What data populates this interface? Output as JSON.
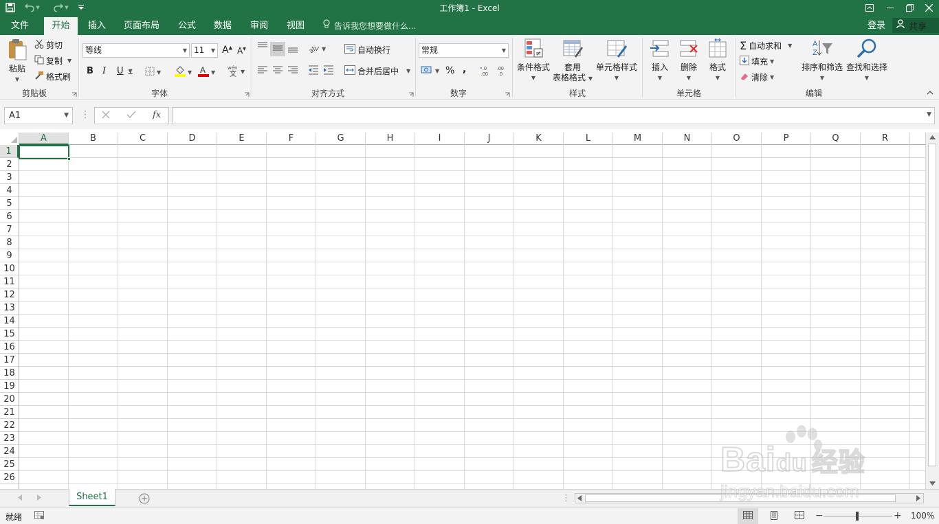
{
  "title_bar": {
    "title": "工作簿1 - Excel"
  },
  "tabs": [
    {
      "label": "文件"
    },
    {
      "label": "开始"
    },
    {
      "label": "插入"
    },
    {
      "label": "页面布局"
    },
    {
      "label": "公式"
    },
    {
      "label": "数据"
    },
    {
      "label": "审阅"
    },
    {
      "label": "视图"
    }
  ],
  "tell_me": "告诉我您想要做什么...",
  "account": {
    "login": "登录",
    "share": "共享"
  },
  "ribbon": {
    "clipboard": {
      "paste": "粘贴",
      "cut": "剪切",
      "copy": "复制",
      "format_painter": "格式刷",
      "label": "剪贴板"
    },
    "font": {
      "font_name": "等线",
      "font_size": "11",
      "bold": "B",
      "italic": "I",
      "underline": "U",
      "label": "字体"
    },
    "alignment": {
      "wrap_text": "自动换行",
      "merge_center": "合并后居中",
      "label": "对齐方式"
    },
    "number": {
      "format": "常规",
      "percent": "%",
      "comma": ",",
      "label": "数字"
    },
    "styles": {
      "conditional": "条件格式",
      "format_table_1": "套用",
      "format_table_2": "表格格式",
      "cell_styles": "单元格样式",
      "label": "样式"
    },
    "cells": {
      "insert": "插入",
      "delete": "删除",
      "format": "格式",
      "label": "单元格"
    },
    "editing": {
      "autosum": "自动求和",
      "fill": "填充",
      "clear": "清除",
      "sort_filter": "排序和筛选",
      "find_select": "查找和选择",
      "label": "编辑"
    }
  },
  "formula_bar": {
    "name_box": "A1",
    "fx": "fx",
    "formula": ""
  },
  "grid": {
    "columns": [
      "A",
      "B",
      "C",
      "D",
      "E",
      "F",
      "G",
      "H",
      "I",
      "J",
      "K",
      "L",
      "M",
      "N",
      "O",
      "P",
      "Q",
      "R"
    ],
    "rows": [
      "1",
      "2",
      "3",
      "4",
      "5",
      "6",
      "7",
      "8",
      "9",
      "10",
      "11",
      "12",
      "13",
      "14",
      "15",
      "16",
      "17",
      "18",
      "19",
      "20",
      "21",
      "22",
      "23",
      "24",
      "25",
      "26"
    ],
    "selected_cell": "A1"
  },
  "sheets": [
    {
      "name": "Sheet1",
      "active": true
    }
  ],
  "status_bar": {
    "ready": "就绪",
    "zoom": "100%"
  },
  "watermark": {
    "brand": "Bai",
    "brand_suffix": "du",
    "cn": "经验",
    "url": "jingyan.baidu.com"
  },
  "colors": {
    "accent": "#217346",
    "ribbon_bg": "#f3f3f3",
    "grid_line": "#dadada"
  }
}
